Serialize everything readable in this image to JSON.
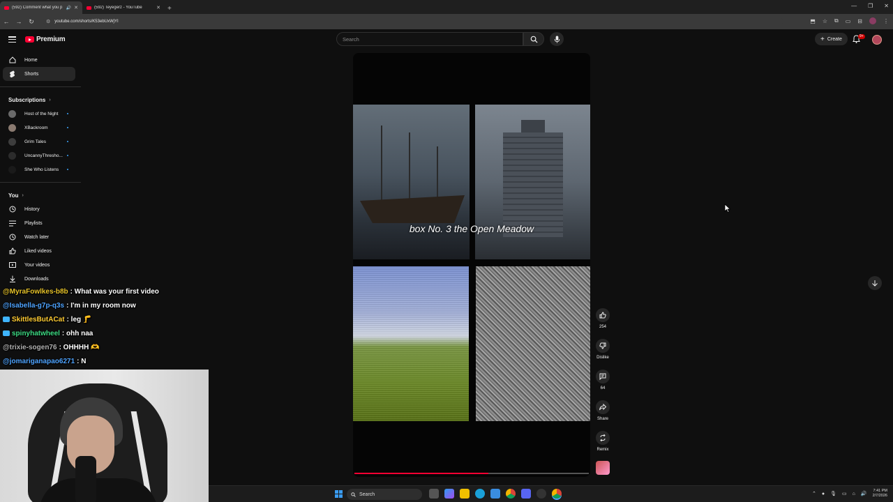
{
  "browser": {
    "tabs": [
      {
        "title": "(592) Comment what you p",
        "active": true
      },
      {
        "title": "(592) Teyegerz - YouTube",
        "active": false
      }
    ],
    "new_tab_symbol": "+",
    "url": "youtube.com/shorts/K53ebUxWjYI",
    "window_controls": [
      "—",
      "❐",
      "✕"
    ]
  },
  "header": {
    "logo_text": "Premium",
    "search_placeholder": "Search",
    "create_label": "Create",
    "notification_count": "9+"
  },
  "sidebar": {
    "main": [
      {
        "label": "Home",
        "icon": "home-icon"
      },
      {
        "label": "Shorts",
        "icon": "shorts-icon",
        "active": true
      }
    ],
    "subscriptions_heading": "Subscriptions",
    "subscriptions": [
      {
        "name": "Host of the Night"
      },
      {
        "name": "XBackroom"
      },
      {
        "name": "Grim Tales"
      },
      {
        "name": "UncannyThresho..."
      },
      {
        "name": "She Who Listens"
      }
    ],
    "you_heading": "You",
    "you_items": [
      {
        "label": "History",
        "icon": "history-icon"
      },
      {
        "label": "Playlists",
        "icon": "playlists-icon"
      },
      {
        "label": "Watch later",
        "icon": "watch-later-icon"
      },
      {
        "label": "Liked videos",
        "icon": "liked-icon"
      },
      {
        "label": "Your videos",
        "icon": "your-videos-icon"
      },
      {
        "label": "Downloads",
        "icon": "downloads-icon"
      }
    ]
  },
  "chat": [
    {
      "user": "@MyraFowlkes-b8b",
      "message": ": What was your first video",
      "color": "#e6c229"
    },
    {
      "user": "@Isabella-g7p-q3s",
      "message": ": I'm in my room now",
      "color": "#4ea3ff"
    },
    {
      "user": "SkittlesButACat",
      "message": ": leg 🦵",
      "color": "#ffcc33",
      "badge": "#3fb5ff"
    },
    {
      "user": "spinyhatwheel",
      "message": ": ohh naa",
      "color": "#3ddc84",
      "badge": "#3fb5ff"
    },
    {
      "user": "@trixie-sogen76",
      "message": ": OHHHH 🫶",
      "color": "#b0b0b0"
    },
    {
      "user": "@jomariganapao6271",
      "message": ": N",
      "color": "#4ea3ff"
    }
  ],
  "player": {
    "caption": "box No. 3 the Open Meadow",
    "progress": 0.57
  },
  "actions": [
    {
      "label": "254",
      "icon": "like-icon"
    },
    {
      "label": "Dislike",
      "icon": "dislike-icon"
    },
    {
      "label": "64",
      "icon": "comment-icon"
    },
    {
      "label": "Share",
      "icon": "share-icon"
    },
    {
      "label": "Remix",
      "icon": "remix-icon"
    }
  ],
  "taskbar": {
    "search_label": "Search",
    "time": "7:41 PM",
    "date": "2/7/2026"
  }
}
